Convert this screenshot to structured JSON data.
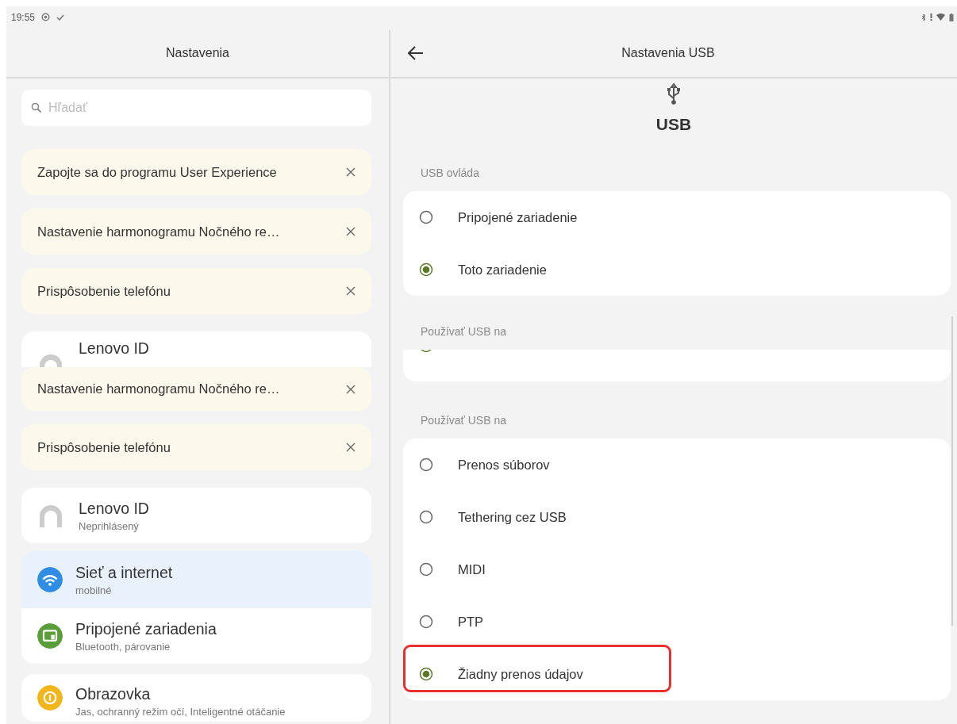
{
  "status_bar": {
    "time": "19:55"
  },
  "left_pane": {
    "title": "Nastavenia",
    "search": {
      "placeholder": "Hľadať"
    },
    "items": [
      {
        "kind": "suggestion",
        "title": "Zapojte sa do programu User Experience"
      },
      {
        "kind": "suggestion",
        "title": "Nastavenie harmonogramu Nočného re…"
      },
      {
        "kind": "suggestion",
        "title": "Prispôsobenie telefónu"
      },
      {
        "kind": "account-partial",
        "title": "Lenovo ID"
      },
      {
        "kind": "suggestion",
        "title": "Nastavenie harmonogramu Nočného re…"
      },
      {
        "kind": "suggestion",
        "title": "Prispôsobenie telefónu"
      },
      {
        "kind": "account",
        "title": "Lenovo ID",
        "subtitle": "Neprihlásený"
      },
      {
        "kind": "category",
        "title": "Sieť a internet",
        "subtitle": "mobilné",
        "color": "#2f8de4",
        "selected": true
      },
      {
        "kind": "category",
        "title": "Pripojené zariadenia",
        "subtitle": "Bluetooth, párovanie",
        "color": "#5a9e3a",
        "selected": false
      },
      {
        "kind": "category",
        "title": "Obrazovka",
        "subtitle": "Jas, ochranný režim očí, Inteligentné otáčanie",
        "color": "#f2b51c",
        "selected": false
      }
    ]
  },
  "right_pane": {
    "title": "Nastavenia USB",
    "header": "USB",
    "sections": [
      {
        "kind": "options",
        "heading": "USB ovláda",
        "options": [
          {
            "label": "Pripojené zariadenie",
            "selected": false,
            "highlighted": false
          },
          {
            "label": "Toto zariadenie",
            "selected": true,
            "highlighted": false
          }
        ]
      },
      {
        "kind": "sliver",
        "heading": "Používať USB na",
        "selected": true
      },
      {
        "kind": "options",
        "heading": "Používať USB na",
        "options": [
          {
            "label": "Prenos súborov",
            "selected": false,
            "highlighted": false
          },
          {
            "label": "Tethering cez USB",
            "selected": false,
            "highlighted": false
          },
          {
            "label": "MIDI",
            "selected": false,
            "highlighted": false
          },
          {
            "label": "PTP",
            "selected": false,
            "highlighted": false
          },
          {
            "label": "Žiadny prenos údajov",
            "selected": true,
            "highlighted": true
          }
        ]
      }
    ]
  }
}
